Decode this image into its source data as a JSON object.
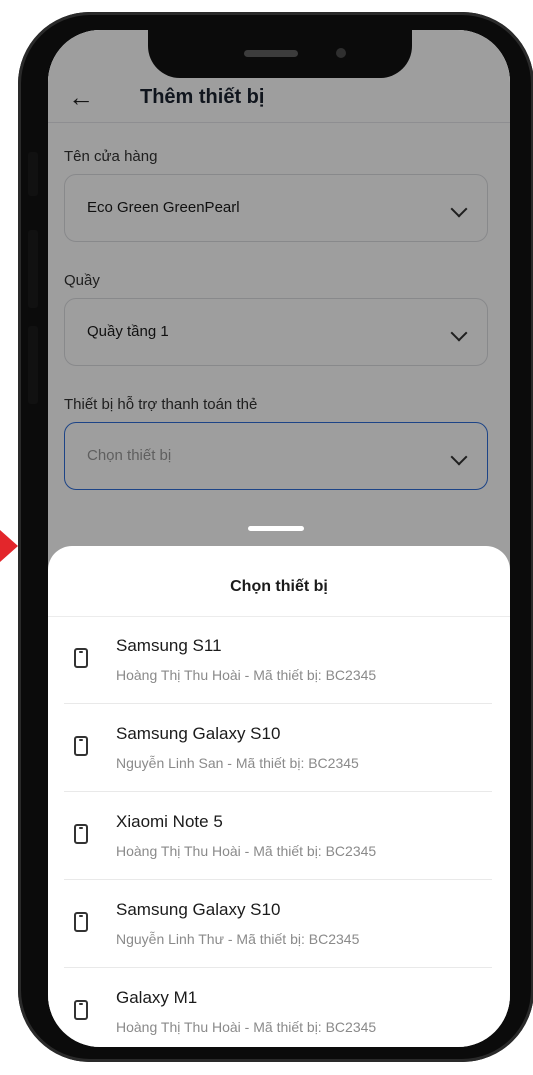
{
  "header": {
    "title": "Thêm thiết bị"
  },
  "form": {
    "store": {
      "label": "Tên cửa hàng",
      "value": "Eco Green GreenPearl"
    },
    "counter": {
      "label": "Quầy",
      "value": "Quầy tầng 1"
    },
    "device": {
      "label": "Thiết bị hỗ trợ thanh toán thẻ",
      "placeholder": "Chọn thiết bị"
    }
  },
  "sheet": {
    "title": "Chọn thiết bị",
    "items": [
      {
        "name": "Samsung S11",
        "subtitle": "Hoàng Thị Thu Hoài - Mã thiết bị: BC2345"
      },
      {
        "name": "Samsung Galaxy S10",
        "subtitle": "Nguyễn Linh San - Mã thiết bị: BC2345"
      },
      {
        "name": "Xiaomi Note 5",
        "subtitle": "Hoàng Thị Thu Hoài - Mã thiết bị: BC2345"
      },
      {
        "name": "Samsung Galaxy S10",
        "subtitle": "Nguyễn Linh Thư - Mã thiết bị: BC2345"
      },
      {
        "name": "Galaxy M1",
        "subtitle": "Hoàng Thị Thu Hoài - Mã thiết bị: BC2345"
      }
    ]
  },
  "colors": {
    "accent": "#2f6fda",
    "pointer": "#e3262b"
  }
}
